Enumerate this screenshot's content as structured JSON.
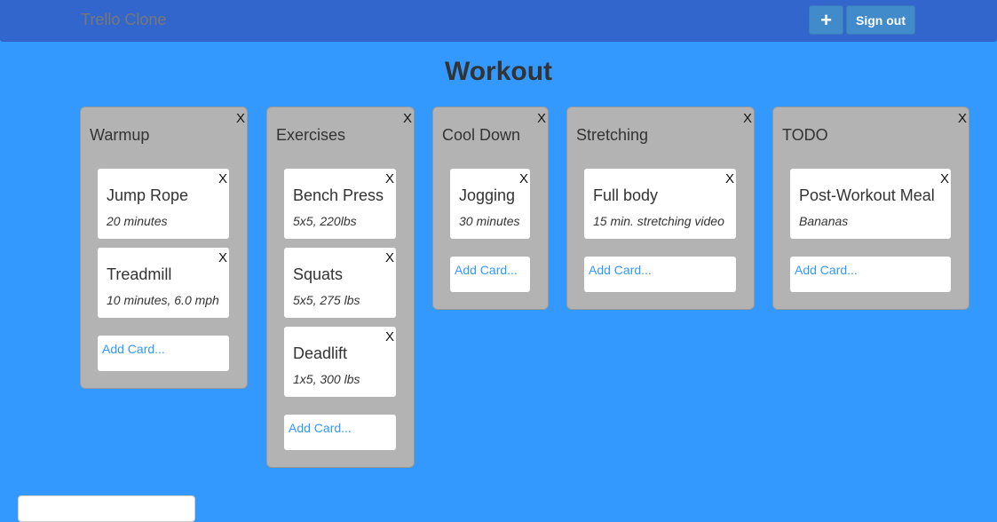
{
  "navbar": {
    "brand": "Trello Clone",
    "add_label": "+",
    "signout_label": "Sign out"
  },
  "board": {
    "title": "Workout",
    "lists": [
      {
        "title": "Warmup",
        "close_label": "X",
        "add_card_label": "Add Card...",
        "cards": [
          {
            "title": "Jump Rope",
            "desc": "20 minutes",
            "close_label": "X"
          },
          {
            "title": "Treadmill",
            "desc": "10 minutes, 6.0 mph",
            "close_label": "X"
          }
        ]
      },
      {
        "title": "Exercises",
        "close_label": "X",
        "add_card_label": "Add Card...",
        "cards": [
          {
            "title": "Bench Press",
            "desc": "5x5, 220lbs",
            "close_label": "X"
          },
          {
            "title": "Squats",
            "desc": "5x5, 275 lbs",
            "close_label": "X"
          },
          {
            "title": "Deadlift",
            "desc": "1x5, 300 lbs",
            "close_label": "X"
          }
        ]
      },
      {
        "title": "Cool Down",
        "close_label": "X",
        "add_card_label": "Add Card...",
        "cards": [
          {
            "title": "Jogging",
            "desc": "30 minutes",
            "close_label": "X"
          }
        ]
      },
      {
        "title": "Stretching",
        "close_label": "X",
        "add_card_label": "Add Card...",
        "cards": [
          {
            "title": "Full body",
            "desc": "15 min. stretching video",
            "close_label": "X"
          }
        ]
      },
      {
        "title": "TODO",
        "close_label": "X",
        "add_card_label": "Add Card...",
        "cards": [
          {
            "title": "Post-Workout Meal",
            "desc": "Bananas",
            "close_label": "X"
          }
        ]
      }
    ]
  },
  "colors": {
    "background": "#3399ff",
    "navbar": "#3366cc",
    "list": "#b3b3b3",
    "link": "#3399ff"
  }
}
